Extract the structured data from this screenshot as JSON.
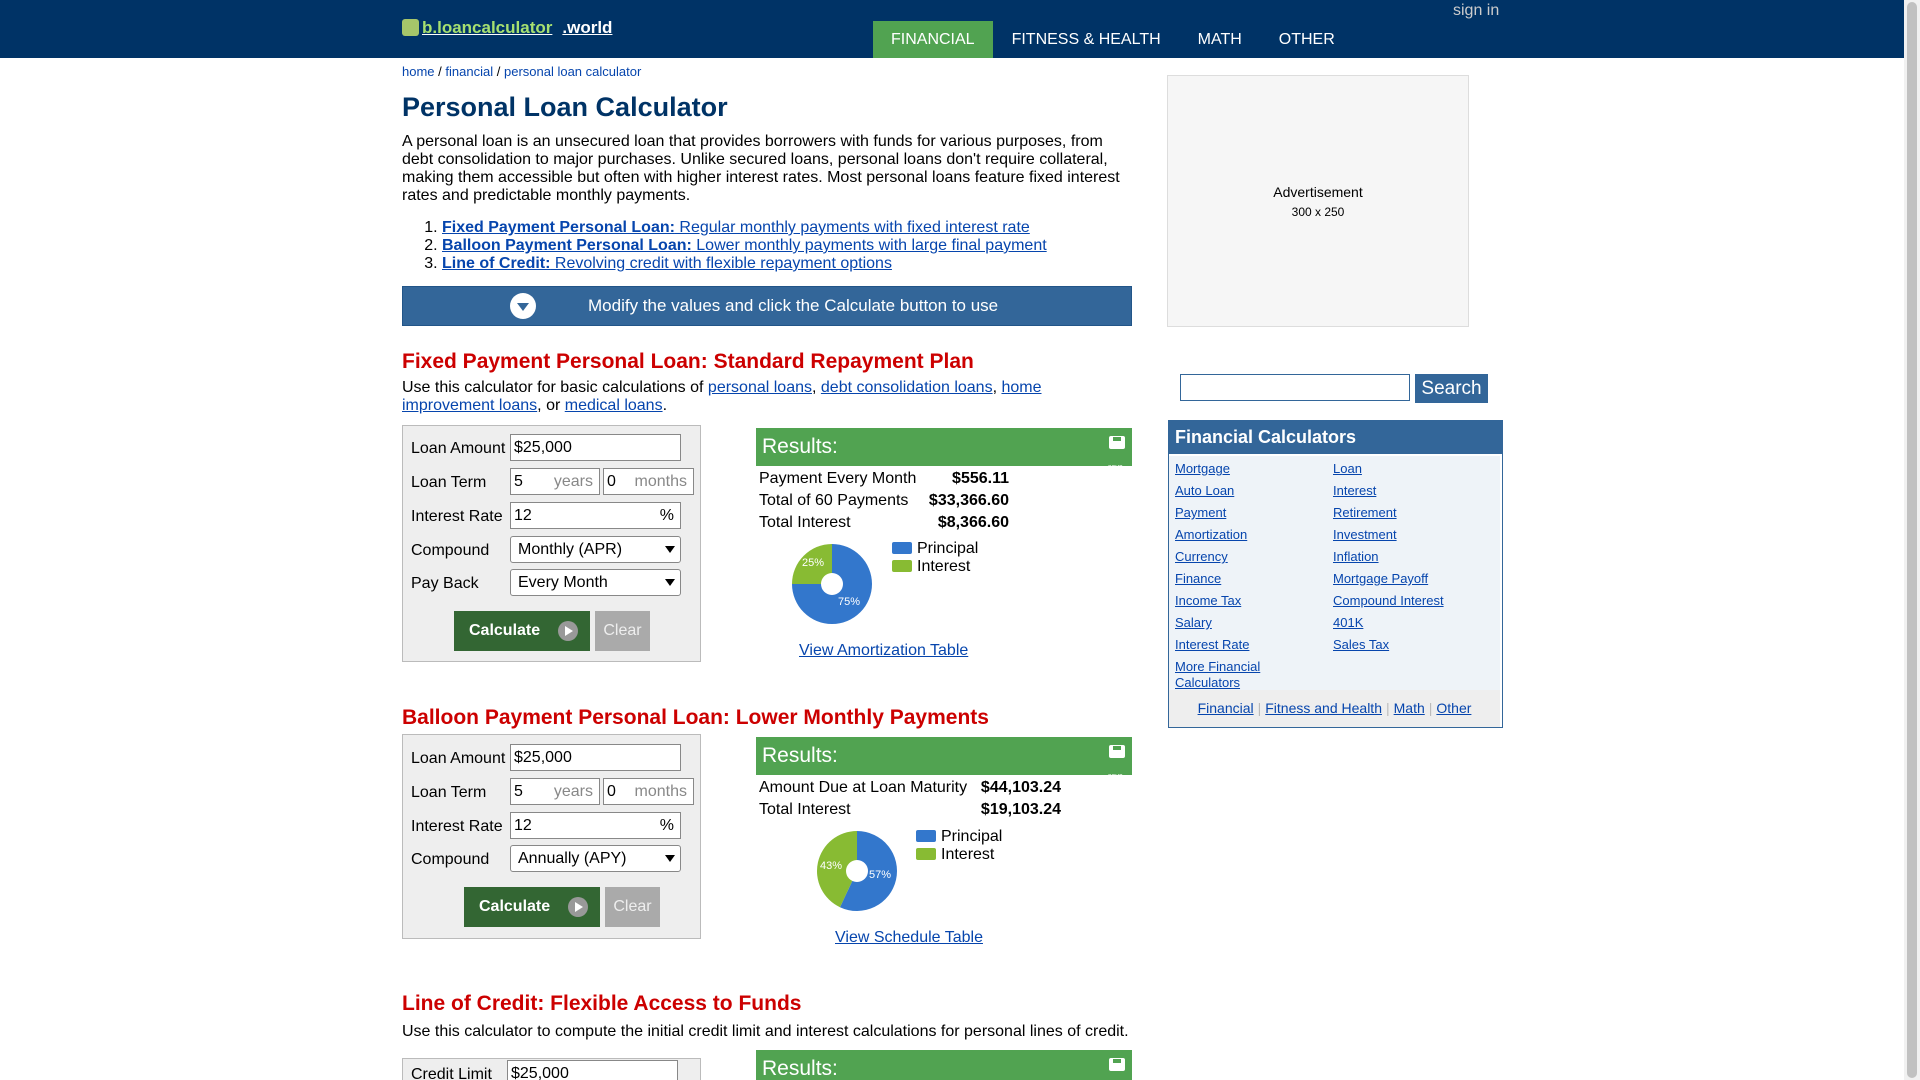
{
  "header": {
    "logo_brand": "b.loancalculator",
    "logo_tld": ".world",
    "sign_in": "sign in",
    "nav": [
      "FINANCIAL",
      "FITNESS & HEALTH",
      "MATH",
      "OTHER"
    ]
  },
  "breadcrumb": {
    "home": "home",
    "financial": "financial",
    "current": "personal loan calculator",
    "sep": "/"
  },
  "page_title": "Personal Loan Calculator",
  "intro": "A personal loan is an unsecured loan that provides borrowers with funds for various purposes, from debt consolidation to major purchases. Unlike secured loans, personal loans don't require collateral, making them accessible but often with higher interest rates. Most personal loans feature fixed interest rates and predictable monthly payments.",
  "toc": [
    {
      "bold": "Fixed Payment Personal Loan:",
      "text": " Regular monthly payments with fixed interest rate"
    },
    {
      "bold": "Balloon Payment Personal Loan:",
      "text": " Lower monthly payments with large final payment"
    },
    {
      "bold": "Line of Credit:",
      "text": " Revolving credit with flexible repayment options"
    }
  ],
  "banner": "Modify the values and click the Calculate button to use",
  "fixed": {
    "title": "Fixed Payment Personal Loan: Standard Repayment Plan",
    "lead_pre": "Use this calculator for basic calculations of ",
    "lead_links": [
      "personal loans",
      "debt consolidation loans",
      "home improvement loans",
      "medical loans"
    ],
    "lead_or": ", or ",
    "form": {
      "loan_amount_label": "Loan Amount",
      "loan_amount": "$25,000",
      "loan_term_label": "Loan Term",
      "years": "5",
      "years_unit": "years",
      "months": "0",
      "months_unit": "months",
      "rate_label": "Interest Rate",
      "rate": "12",
      "rate_unit": "%",
      "compound_label": "Compound",
      "compound": "Monthly (APR)",
      "payback_label": "Pay Back",
      "payback": "Every Month",
      "calculate": "Calculate",
      "clear": "Clear"
    },
    "results": {
      "title": "Results:",
      "save": "save",
      "rows": [
        {
          "label": "Payment Every Month",
          "value": "$556.11"
        },
        {
          "label": "Total of 60 Payments",
          "value": "$33,366.60"
        },
        {
          "label": "Total Interest",
          "value": "$8,366.60"
        }
      ],
      "pie": {
        "principal_pct": 75,
        "interest_pct": 25,
        "principal_label": "75%",
        "interest_label": "25%"
      },
      "legend": [
        "Principal",
        "Interest"
      ],
      "link": "View Amortization Table"
    }
  },
  "balloon": {
    "title": "Balloon Payment Personal Loan: Lower Monthly Payments",
    "form": {
      "loan_amount_label": "Loan Amount",
      "loan_amount": "$25,000",
      "loan_term_label": "Loan Term",
      "years": "5",
      "years_unit": "years",
      "months": "0",
      "months_unit": "months",
      "rate_label": "Interest Rate",
      "rate": "12",
      "rate_unit": "%",
      "compound_label": "Compound",
      "compound": "Annually (APY)",
      "calculate": "Calculate",
      "clear": "Clear"
    },
    "results": {
      "title": "Results:",
      "save": "save",
      "rows": [
        {
          "label": "Amount Due at Loan Maturity",
          "value": "$44,103.24"
        },
        {
          "label": "Total Interest",
          "value": "$19,103.24"
        }
      ],
      "pie": {
        "principal_pct": 57,
        "interest_pct": 43,
        "principal_label": "57%",
        "interest_label": "43%"
      },
      "legend": [
        "Principal",
        "Interest"
      ],
      "link": "View Schedule Table"
    }
  },
  "credit": {
    "title": "Line of Credit: Flexible Access to Funds",
    "lead": "Use this calculator to compute the initial credit limit and interest calculations for personal lines of credit.",
    "form": {
      "credit_limit_label": "Credit Limit",
      "credit_limit": "$25,000"
    },
    "results": {
      "title": "Results:"
    }
  },
  "sidebar": {
    "ad_title": "Advertisement",
    "ad_size": "300 x 250",
    "search_button": "Search",
    "fin_title": "Financial Calculators",
    "left_links": [
      "Mortgage",
      "Auto Loan",
      "Payment",
      "Amortization",
      "Currency",
      "Finance",
      "Income Tax",
      "Salary",
      "Interest Rate",
      "More Financial Calculators"
    ],
    "right_links": [
      "Loan",
      "Interest",
      "Retirement",
      "Investment",
      "Inflation",
      "Mortgage Payoff",
      "Compound Interest",
      "401K",
      "Sales Tax"
    ],
    "footer_links": [
      "Financial",
      "Fitness and Health",
      "Math",
      "Other"
    ]
  },
  "colors": {
    "header": "#003366",
    "accent_green": "#51a351",
    "principal": "#3377cc",
    "interest": "#88bb33",
    "heading_red": "#cc0000"
  }
}
